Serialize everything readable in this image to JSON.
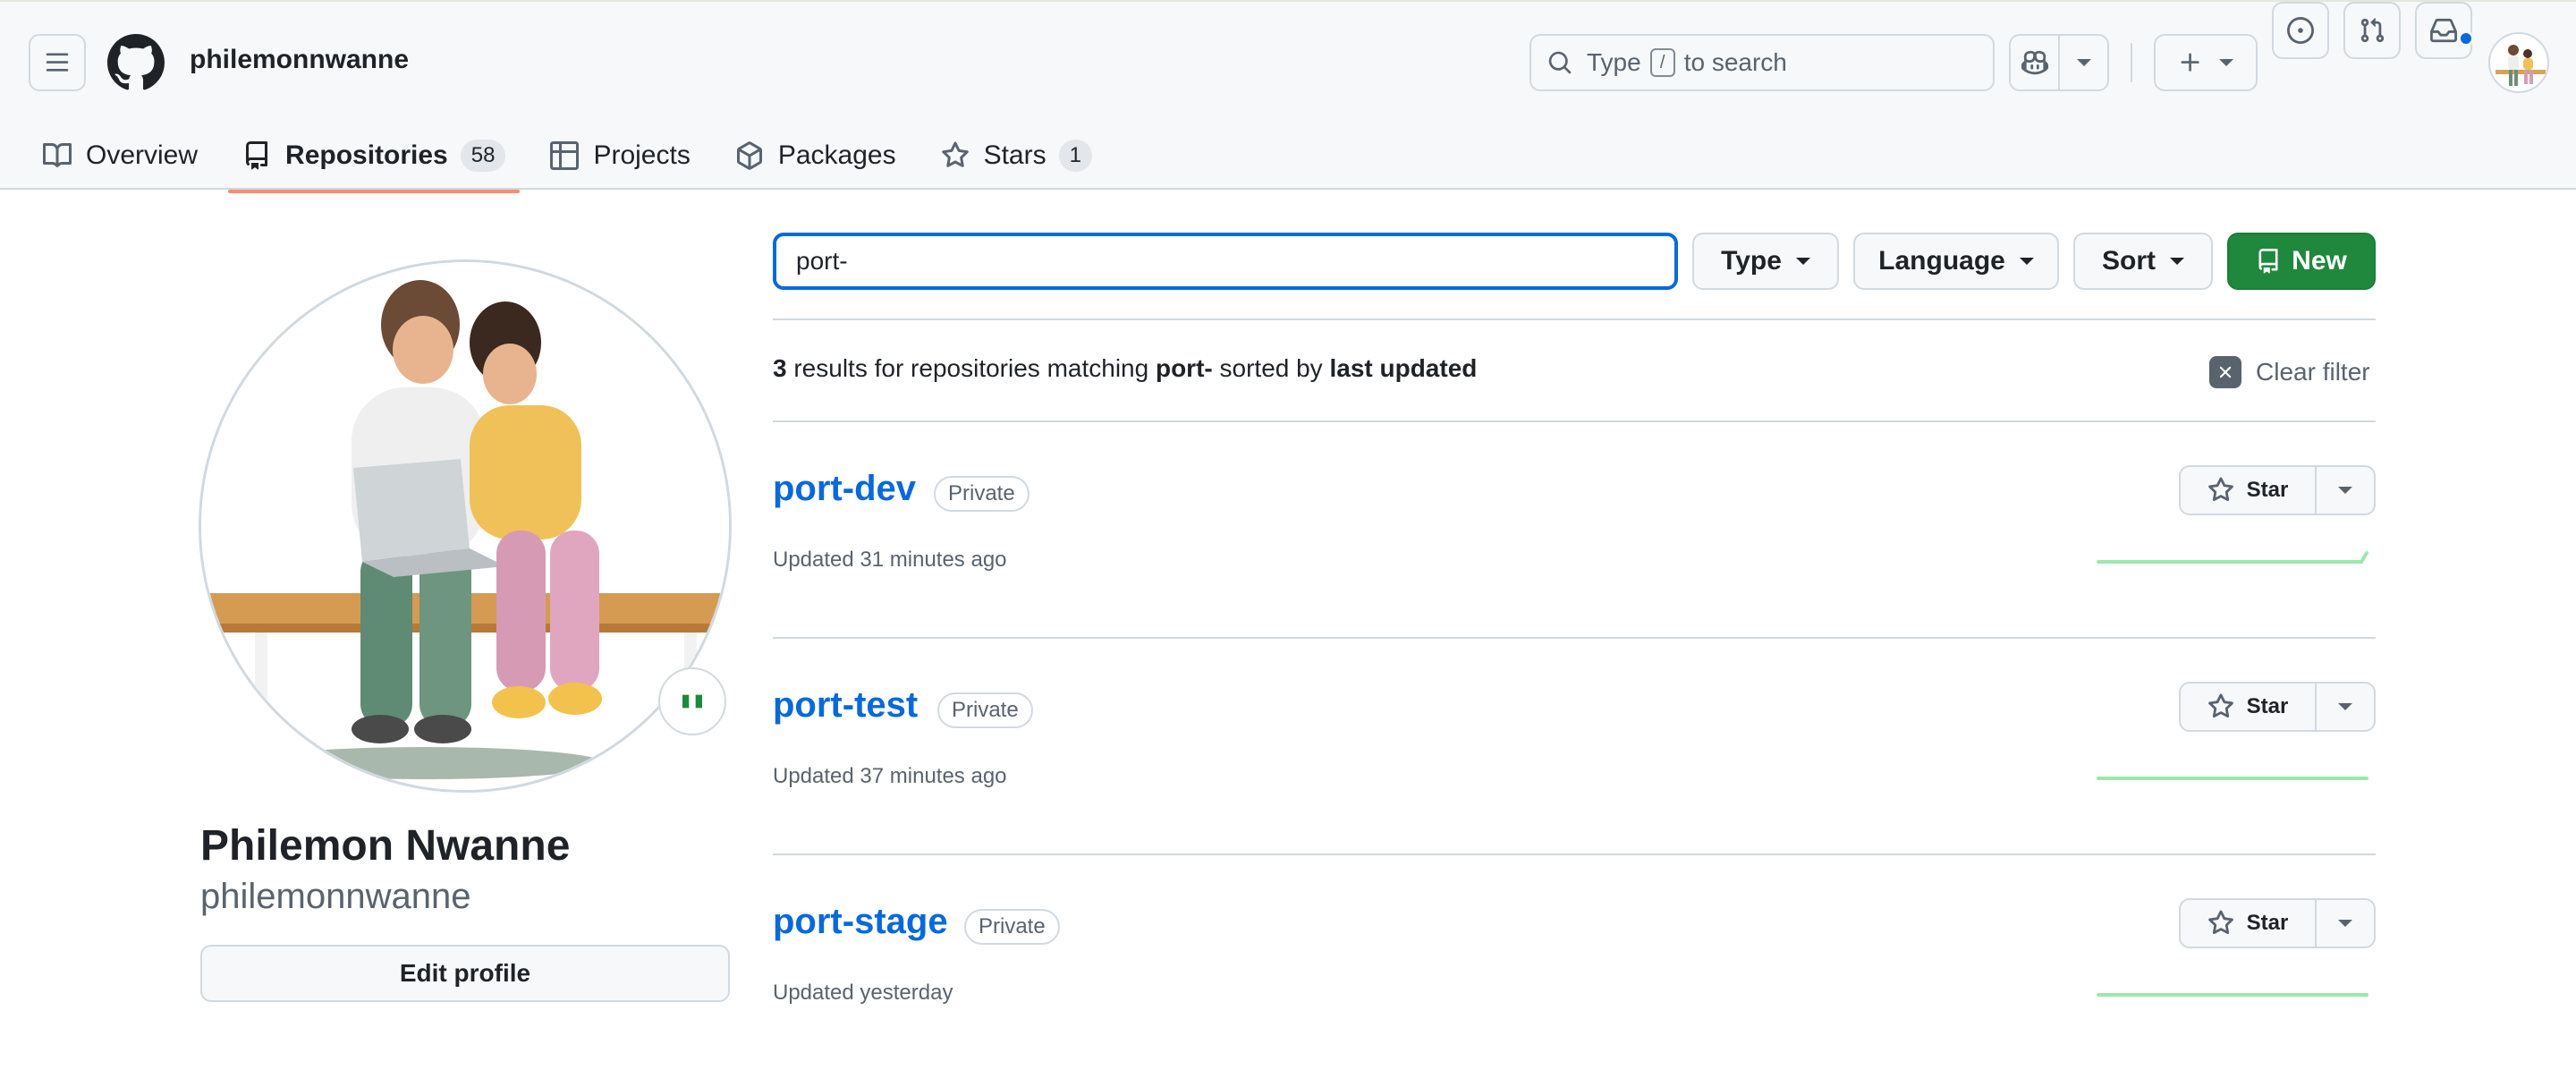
{
  "header": {
    "username": "philemonnwanne",
    "search": {
      "prefix": "Type",
      "key": "/",
      "suffix": "to search"
    }
  },
  "tabs": [
    {
      "label": "Overview",
      "icon": "book-icon"
    },
    {
      "label": "Repositories",
      "icon": "repo-icon",
      "count": "58",
      "active": true
    },
    {
      "label": "Projects",
      "icon": "table-icon"
    },
    {
      "label": "Packages",
      "icon": "package-icon"
    },
    {
      "label": "Stars",
      "icon": "star-icon",
      "count": "1"
    }
  ],
  "profile": {
    "full_name": "Philemon Nwanne",
    "handle": "philemonnwanne",
    "edit_label": "Edit profile",
    "status_emoji": "🇳🇬"
  },
  "filters": {
    "query": "port-",
    "type_label": "Type",
    "language_label": "Language",
    "sort_label": "Sort",
    "new_label": "New"
  },
  "results": {
    "count": "3",
    "text1": " results for repositories matching ",
    "query": "port-",
    "text2": " sorted by ",
    "sort": "last updated",
    "clear_label": "Clear filter"
  },
  "repos": [
    {
      "name": "port-dev",
      "visibility": "Private",
      "updated": "Updated 31 minutes ago",
      "star_label": "Star"
    },
    {
      "name": "port-test",
      "visibility": "Private",
      "updated": "Updated 37 minutes ago",
      "star_label": "Star"
    },
    {
      "name": "port-stage",
      "visibility": "Private",
      "updated": "Updated yesterday",
      "star_label": "Star"
    }
  ],
  "colors": {
    "accent": "#0969da",
    "primary_button": "#1f883d",
    "active_tab_underline": "#fd8c73",
    "sparkline": "#9be9a8"
  }
}
